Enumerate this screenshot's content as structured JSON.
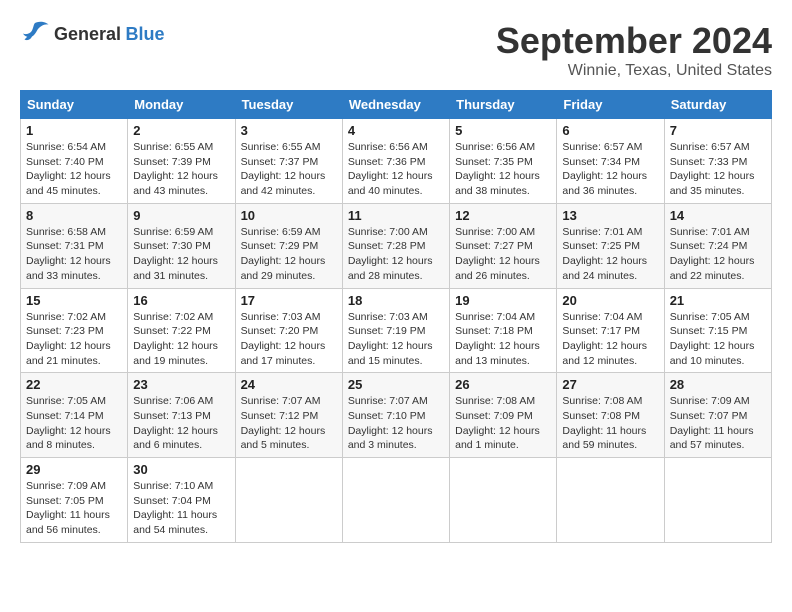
{
  "logo": {
    "general": "General",
    "blue": "Blue"
  },
  "title": "September 2024",
  "subtitle": "Winnie, Texas, United States",
  "days_of_week": [
    "Sunday",
    "Monday",
    "Tuesday",
    "Wednesday",
    "Thursday",
    "Friday",
    "Saturday"
  ],
  "weeks": [
    [
      {
        "day": "1",
        "sunrise": "6:54 AM",
        "sunset": "7:40 PM",
        "daylight": "12 hours and 45 minutes."
      },
      {
        "day": "2",
        "sunrise": "6:55 AM",
        "sunset": "7:39 PM",
        "daylight": "12 hours and 43 minutes."
      },
      {
        "day": "3",
        "sunrise": "6:55 AM",
        "sunset": "7:37 PM",
        "daylight": "12 hours and 42 minutes."
      },
      {
        "day": "4",
        "sunrise": "6:56 AM",
        "sunset": "7:36 PM",
        "daylight": "12 hours and 40 minutes."
      },
      {
        "day": "5",
        "sunrise": "6:56 AM",
        "sunset": "7:35 PM",
        "daylight": "12 hours and 38 minutes."
      },
      {
        "day": "6",
        "sunrise": "6:57 AM",
        "sunset": "7:34 PM",
        "daylight": "12 hours and 36 minutes."
      },
      {
        "day": "7",
        "sunrise": "6:57 AM",
        "sunset": "7:33 PM",
        "daylight": "12 hours and 35 minutes."
      }
    ],
    [
      {
        "day": "8",
        "sunrise": "6:58 AM",
        "sunset": "7:31 PM",
        "daylight": "12 hours and 33 minutes."
      },
      {
        "day": "9",
        "sunrise": "6:59 AM",
        "sunset": "7:30 PM",
        "daylight": "12 hours and 31 minutes."
      },
      {
        "day": "10",
        "sunrise": "6:59 AM",
        "sunset": "7:29 PM",
        "daylight": "12 hours and 29 minutes."
      },
      {
        "day": "11",
        "sunrise": "7:00 AM",
        "sunset": "7:28 PM",
        "daylight": "12 hours and 28 minutes."
      },
      {
        "day": "12",
        "sunrise": "7:00 AM",
        "sunset": "7:27 PM",
        "daylight": "12 hours and 26 minutes."
      },
      {
        "day": "13",
        "sunrise": "7:01 AM",
        "sunset": "7:25 PM",
        "daylight": "12 hours and 24 minutes."
      },
      {
        "day": "14",
        "sunrise": "7:01 AM",
        "sunset": "7:24 PM",
        "daylight": "12 hours and 22 minutes."
      }
    ],
    [
      {
        "day": "15",
        "sunrise": "7:02 AM",
        "sunset": "7:23 PM",
        "daylight": "12 hours and 21 minutes."
      },
      {
        "day": "16",
        "sunrise": "7:02 AM",
        "sunset": "7:22 PM",
        "daylight": "12 hours and 19 minutes."
      },
      {
        "day": "17",
        "sunrise": "7:03 AM",
        "sunset": "7:20 PM",
        "daylight": "12 hours and 17 minutes."
      },
      {
        "day": "18",
        "sunrise": "7:03 AM",
        "sunset": "7:19 PM",
        "daylight": "12 hours and 15 minutes."
      },
      {
        "day": "19",
        "sunrise": "7:04 AM",
        "sunset": "7:18 PM",
        "daylight": "12 hours and 13 minutes."
      },
      {
        "day": "20",
        "sunrise": "7:04 AM",
        "sunset": "7:17 PM",
        "daylight": "12 hours and 12 minutes."
      },
      {
        "day": "21",
        "sunrise": "7:05 AM",
        "sunset": "7:15 PM",
        "daylight": "12 hours and 10 minutes."
      }
    ],
    [
      {
        "day": "22",
        "sunrise": "7:05 AM",
        "sunset": "7:14 PM",
        "daylight": "12 hours and 8 minutes."
      },
      {
        "day": "23",
        "sunrise": "7:06 AM",
        "sunset": "7:13 PM",
        "daylight": "12 hours and 6 minutes."
      },
      {
        "day": "24",
        "sunrise": "7:07 AM",
        "sunset": "7:12 PM",
        "daylight": "12 hours and 5 minutes."
      },
      {
        "day": "25",
        "sunrise": "7:07 AM",
        "sunset": "7:10 PM",
        "daylight": "12 hours and 3 minutes."
      },
      {
        "day": "26",
        "sunrise": "7:08 AM",
        "sunset": "7:09 PM",
        "daylight": "12 hours and 1 minute."
      },
      {
        "day": "27",
        "sunrise": "7:08 AM",
        "sunset": "7:08 PM",
        "daylight": "11 hours and 59 minutes."
      },
      {
        "day": "28",
        "sunrise": "7:09 AM",
        "sunset": "7:07 PM",
        "daylight": "11 hours and 57 minutes."
      }
    ],
    [
      {
        "day": "29",
        "sunrise": "7:09 AM",
        "sunset": "7:05 PM",
        "daylight": "11 hours and 56 minutes."
      },
      {
        "day": "30",
        "sunrise": "7:10 AM",
        "sunset": "7:04 PM",
        "daylight": "11 hours and 54 minutes."
      },
      null,
      null,
      null,
      null,
      null
    ]
  ],
  "labels": {
    "sunrise": "Sunrise:",
    "sunset": "Sunset:",
    "daylight": "Daylight:"
  }
}
